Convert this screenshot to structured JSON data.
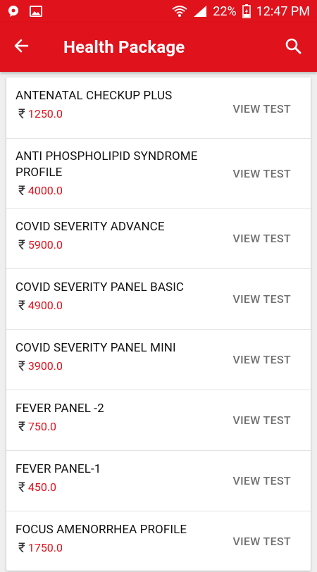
{
  "status": {
    "battery": "22%",
    "time": "12:47 PM"
  },
  "header": {
    "title": "Health Package",
    "back_icon": "arrow-back-icon",
    "search_icon": "search-icon"
  },
  "currency_symbol": "₹",
  "view_label": "VIEW TEST",
  "colors": {
    "primary": "#e0121c",
    "price": "#e0121c",
    "view": "#707070"
  },
  "packages": [
    {
      "name": "ANTENATAL CHECKUP PLUS",
      "price": "1250.0"
    },
    {
      "name": "ANTI PHOSPHOLIPID SYNDROME PROFILE",
      "price": "4000.0"
    },
    {
      "name": "COVID SEVERITY ADVANCE",
      "price": "5900.0"
    },
    {
      "name": "COVID SEVERITY PANEL BASIC",
      "price": "4900.0"
    },
    {
      "name": "COVID SEVERITY PANEL MINI",
      "price": "3900.0"
    },
    {
      "name": "FEVER PANEL -2",
      "price": "750.0"
    },
    {
      "name": "FEVER PANEL-1",
      "price": "450.0"
    },
    {
      "name": "FOCUS AMENORRHEA PROFILE",
      "price": "1750.0"
    }
  ]
}
